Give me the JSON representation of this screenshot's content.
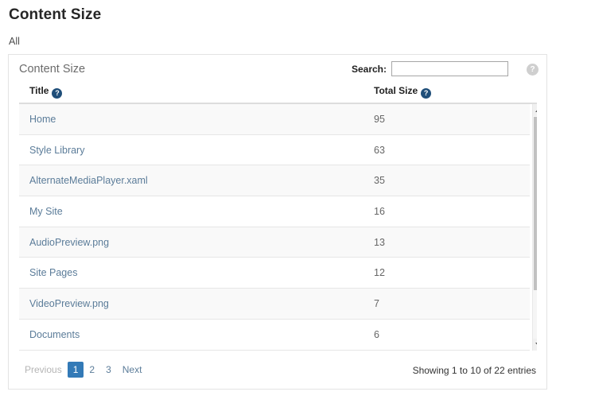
{
  "page": {
    "title": "Content Size",
    "subtitle": "All"
  },
  "panel": {
    "heading": "Content Size",
    "help_icon": "help-circle-icon",
    "help_glyph": "?"
  },
  "search": {
    "label": "Search:",
    "value": "",
    "placeholder": ""
  },
  "table": {
    "columns": [
      {
        "label": "Title",
        "help_glyph": "?"
      },
      {
        "label": "Total Size",
        "help_glyph": "?"
      }
    ],
    "rows": [
      {
        "title": "Home",
        "size": "95"
      },
      {
        "title": "Style Library",
        "size": "63"
      },
      {
        "title": "AlternateMediaPlayer.xaml",
        "size": "35"
      },
      {
        "title": "My Site",
        "size": "16"
      },
      {
        "title": "AudioPreview.png",
        "size": "13"
      },
      {
        "title": "Site Pages",
        "size": "12"
      },
      {
        "title": "VideoPreview.png",
        "size": "7"
      },
      {
        "title": "Documents",
        "size": "6"
      }
    ]
  },
  "scrollbar": {
    "up_icon": "chevron-up-icon",
    "down_icon": "chevron-down-icon"
  },
  "footer": {
    "previous_label": "Previous",
    "pages": [
      "1",
      "2",
      "3"
    ],
    "active_page": "1",
    "next_label": "Next",
    "showing": "Showing 1 to 10 of 22 entries"
  },
  "colors": {
    "accent": "#337ab7",
    "link": "#5b7c99",
    "help_blue": "#1f4e79",
    "help_gray": "#cfcfcf",
    "row_stripe": "#f9f9f9"
  }
}
